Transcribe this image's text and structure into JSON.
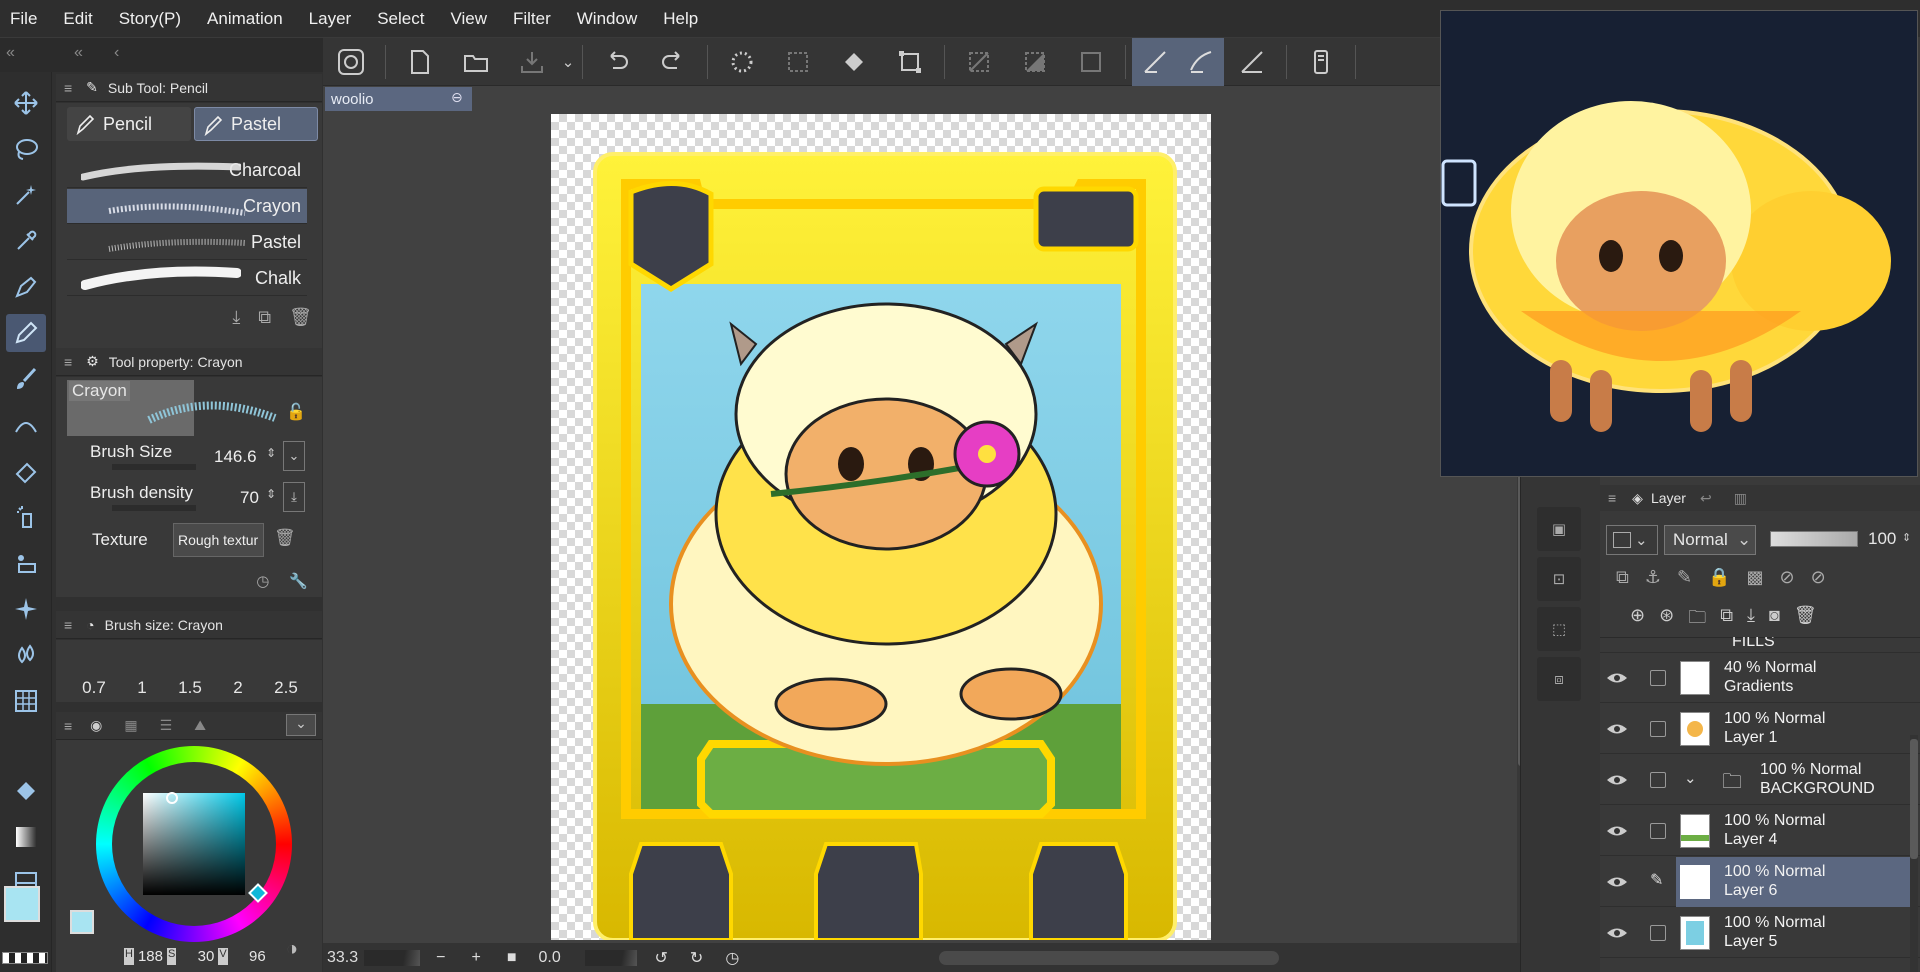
{
  "menu": [
    "File",
    "Edit",
    "Story(P)",
    "Animation",
    "Layer",
    "Select",
    "View",
    "Filter",
    "Window",
    "Help"
  ],
  "document": {
    "tab_label": "woolio"
  },
  "subtool": {
    "header": "Sub Tool: Pencil",
    "tabs": [
      "Pencil",
      "Pastel"
    ],
    "brushes": [
      "Charcoal",
      "Crayon",
      "Pastel",
      "Chalk"
    ]
  },
  "tool_property": {
    "header": "Tool property: Crayon",
    "preview_label": "Crayon",
    "brush_size_label": "Brush Size",
    "brush_size_value": "146.6",
    "brush_density_label": "Brush density",
    "brush_density_value": "70",
    "texture_label": "Texture",
    "texture_value": "Rough textur"
  },
  "brush_size_panel": {
    "header": "Brush size: Crayon",
    "sizes": [
      "0.7",
      "1",
      "1.5",
      "2",
      "2.5"
    ]
  },
  "color": {
    "main": "#a8e4f2",
    "sub": "#f39ac4",
    "hsv": {
      "h_label": "H",
      "h": "188",
      "s_label": "S",
      "s": "30",
      "v_label": "V",
      "v": "96"
    }
  },
  "status": {
    "zoom": "33.3",
    "rotation": "0.0"
  },
  "layer_panel": {
    "tab": "Layer",
    "blend_mode": "Normal",
    "opacity": "100",
    "layers": [
      {
        "line1": "",
        "line2": "FILLS",
        "type": "folder",
        "selected": false
      },
      {
        "line1": "40 % Normal",
        "line2": "Gradients",
        "type": "layer",
        "selected": false
      },
      {
        "line1": "100 % Normal",
        "line2": "Layer 1",
        "type": "layer",
        "selected": false
      },
      {
        "line1": "100 % Normal",
        "line2": "BACKGROUND",
        "type": "folder",
        "selected": false
      },
      {
        "line1": "100 % Normal",
        "line2": "Layer 4",
        "type": "layer",
        "selected": false
      },
      {
        "line1": "100 % Normal",
        "line2": "Layer 6",
        "type": "layer",
        "selected": true
      },
      {
        "line1": "100 % Normal",
        "line2": "Layer 5",
        "type": "layer",
        "selected": false
      }
    ]
  }
}
